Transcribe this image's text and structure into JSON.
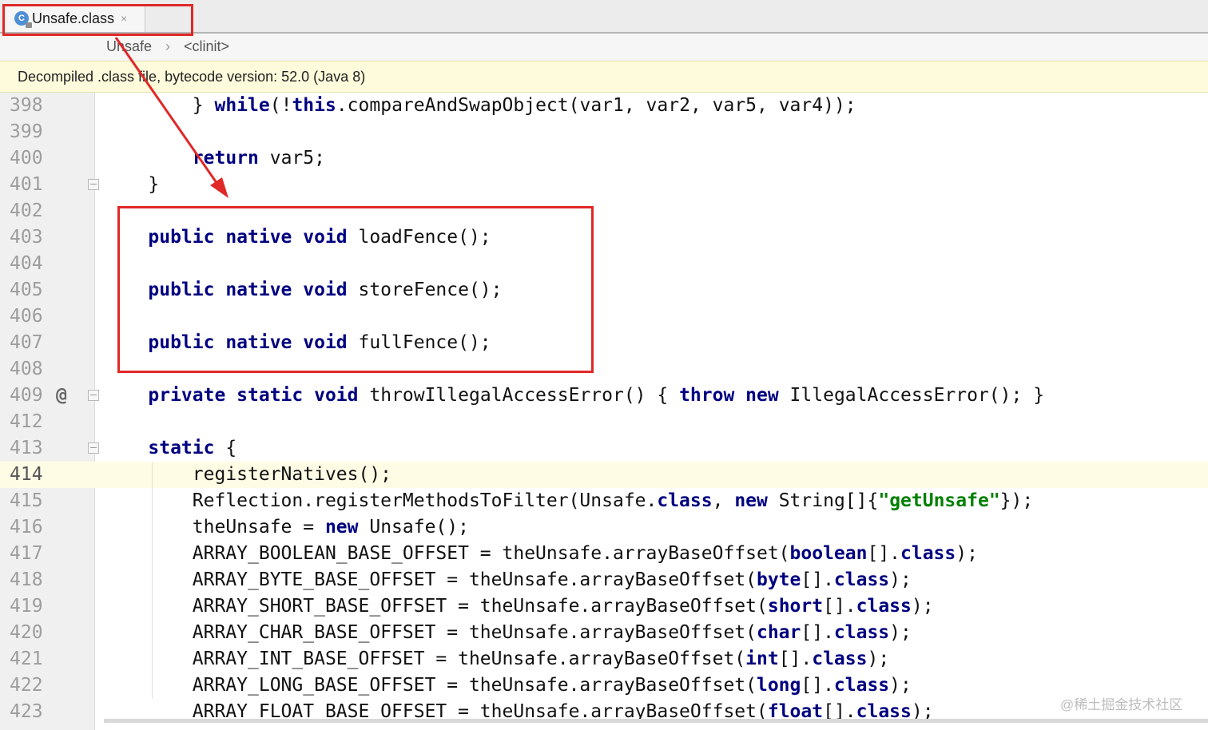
{
  "tab": {
    "label": "Unsafe.class",
    "close": "×",
    "icon_letter": "C"
  },
  "breadcrumb": {
    "items": [
      "Unsafe",
      "<clinit>"
    ],
    "separator": "›"
  },
  "banner": {
    "text": "Decompiled .class file, bytecode version: 52.0 (Java 8)"
  },
  "editor": {
    "current_line": "414",
    "lines": [
      {
        "num": "398",
        "marker": "",
        "fold": false,
        "code": [
          [
            "",
            "        } "
          ],
          [
            "kw",
            "while"
          ],
          [
            "",
            "(!"
          ],
          [
            "kw",
            "this"
          ],
          [
            "",
            ".compareAndSwapObject(var1, var2, var5, var4));"
          ]
        ]
      },
      {
        "num": "399",
        "marker": "",
        "fold": false,
        "code": []
      },
      {
        "num": "400",
        "marker": "",
        "fold": false,
        "code": [
          [
            "",
            "        "
          ],
          [
            "kw",
            "return"
          ],
          [
            "",
            " var5;"
          ]
        ]
      },
      {
        "num": "401",
        "marker": "",
        "fold": true,
        "code": [
          [
            "",
            "    }"
          ]
        ]
      },
      {
        "num": "402",
        "marker": "",
        "fold": false,
        "code": []
      },
      {
        "num": "403",
        "marker": "",
        "fold": false,
        "code": [
          [
            "",
            "    "
          ],
          [
            "kw",
            "public native void"
          ],
          [
            "",
            " loadFence();"
          ]
        ]
      },
      {
        "num": "404",
        "marker": "",
        "fold": false,
        "code": []
      },
      {
        "num": "405",
        "marker": "",
        "fold": false,
        "code": [
          [
            "",
            "    "
          ],
          [
            "kw",
            "public native void"
          ],
          [
            "",
            " storeFence();"
          ]
        ]
      },
      {
        "num": "406",
        "marker": "",
        "fold": false,
        "code": []
      },
      {
        "num": "407",
        "marker": "",
        "fold": false,
        "code": [
          [
            "",
            "    "
          ],
          [
            "kw",
            "public native void"
          ],
          [
            "",
            " fullFence();"
          ]
        ]
      },
      {
        "num": "408",
        "marker": "",
        "fold": false,
        "code": []
      },
      {
        "num": "409",
        "marker": "@",
        "fold": true,
        "code": [
          [
            "",
            "    "
          ],
          [
            "kw",
            "private static void"
          ],
          [
            "",
            " throwIllegalAccessError() { "
          ],
          [
            "kw",
            "throw new"
          ],
          [
            "",
            " IllegalAccessError(); }"
          ]
        ]
      },
      {
        "num": "412",
        "marker": "",
        "fold": false,
        "code": []
      },
      {
        "num": "413",
        "marker": "",
        "fold": true,
        "code": [
          [
            "",
            "    "
          ],
          [
            "kw",
            "static"
          ],
          [
            "",
            " {"
          ]
        ]
      },
      {
        "num": "414",
        "marker": "",
        "fold": false,
        "code": [
          [
            "",
            "        registerNatives();"
          ]
        ]
      },
      {
        "num": "415",
        "marker": "",
        "fold": false,
        "code": [
          [
            "",
            "        Reflection.registerMethodsToFilter(Unsafe."
          ],
          [
            "kw",
            "class"
          ],
          [
            "",
            ", "
          ],
          [
            "kw",
            "new"
          ],
          [
            "",
            " String[]{"
          ],
          [
            "str",
            "\"getUnsafe\""
          ],
          [
            "",
            "});"
          ]
        ]
      },
      {
        "num": "416",
        "marker": "",
        "fold": false,
        "code": [
          [
            "",
            "        theUnsafe = "
          ],
          [
            "kw",
            "new"
          ],
          [
            "",
            " Unsafe();"
          ]
        ]
      },
      {
        "num": "417",
        "marker": "",
        "fold": false,
        "code": [
          [
            "",
            "        ARRAY_BOOLEAN_BASE_OFFSET = theUnsafe.arrayBaseOffset("
          ],
          [
            "kw",
            "boolean"
          ],
          [
            "",
            "[]."
          ],
          [
            "kw",
            "class"
          ],
          [
            "",
            ");"
          ]
        ]
      },
      {
        "num": "418",
        "marker": "",
        "fold": false,
        "code": [
          [
            "",
            "        ARRAY_BYTE_BASE_OFFSET = theUnsafe.arrayBaseOffset("
          ],
          [
            "kw",
            "byte"
          ],
          [
            "",
            "[]."
          ],
          [
            "kw",
            "class"
          ],
          [
            "",
            ");"
          ]
        ]
      },
      {
        "num": "419",
        "marker": "",
        "fold": false,
        "code": [
          [
            "",
            "        ARRAY_SHORT_BASE_OFFSET = theUnsafe.arrayBaseOffset("
          ],
          [
            "kw",
            "short"
          ],
          [
            "",
            "[]."
          ],
          [
            "kw",
            "class"
          ],
          [
            "",
            ");"
          ]
        ]
      },
      {
        "num": "420",
        "marker": "",
        "fold": false,
        "code": [
          [
            "",
            "        ARRAY_CHAR_BASE_OFFSET = theUnsafe.arrayBaseOffset("
          ],
          [
            "kw",
            "char"
          ],
          [
            "",
            "[]."
          ],
          [
            "kw",
            "class"
          ],
          [
            "",
            ");"
          ]
        ]
      },
      {
        "num": "421",
        "marker": "",
        "fold": false,
        "code": [
          [
            "",
            "        ARRAY_INT_BASE_OFFSET = theUnsafe.arrayBaseOffset("
          ],
          [
            "kw",
            "int"
          ],
          [
            "",
            "[]."
          ],
          [
            "kw",
            "class"
          ],
          [
            "",
            ");"
          ]
        ]
      },
      {
        "num": "422",
        "marker": "",
        "fold": false,
        "code": [
          [
            "",
            "        ARRAY_LONG_BASE_OFFSET = theUnsafe.arrayBaseOffset("
          ],
          [
            "kw",
            "long"
          ],
          [
            "",
            "[]."
          ],
          [
            "kw",
            "class"
          ],
          [
            "",
            ");"
          ]
        ]
      },
      {
        "num": "423",
        "marker": "",
        "fold": false,
        "code": [
          [
            "",
            "        ARRAY_FLOAT_BASE_OFFSET = theUnsafe.arrayBaseOffset("
          ],
          [
            "kw",
            "float"
          ],
          [
            "",
            "[]."
          ],
          [
            "kw",
            "class"
          ],
          [
            "",
            ");"
          ]
        ]
      }
    ]
  },
  "watermark": "@稀土掘金技术社区",
  "colors": {
    "keyword": "#000080",
    "string": "#008000",
    "annotation": "#e02828",
    "banner_bg": "#fdfbdb",
    "current_line_bg": "#fffce6"
  }
}
